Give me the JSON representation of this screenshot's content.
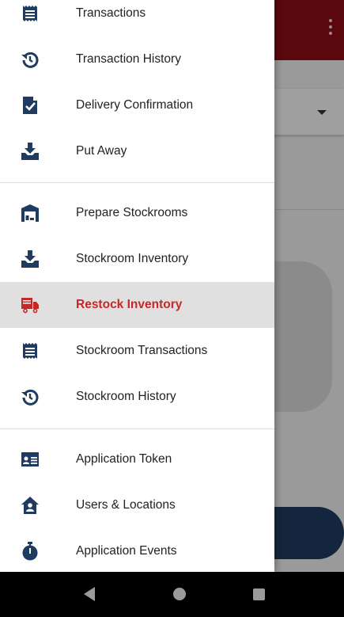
{
  "colors": {
    "icon": "#1f3b5f",
    "accent": "#c62828",
    "appbar": "#8b0d16",
    "selected_bg": "#e0e0e0"
  },
  "drawer": {
    "items": [
      {
        "label": "Transactions",
        "icon": "receipt-icon"
      },
      {
        "label": "Transaction History",
        "icon": "history-icon"
      },
      {
        "label": "Delivery Confirmation",
        "icon": "document-check-icon"
      },
      {
        "label": "Put Away",
        "icon": "tray-download-icon"
      },
      {
        "label": "Prepare Stockrooms",
        "icon": "warehouse-icon"
      },
      {
        "label": "Stockroom Inventory",
        "icon": "tray-download-icon"
      },
      {
        "label": "Restock Inventory",
        "icon": "truck-icon",
        "selected": true
      },
      {
        "label": "Stockroom Transactions",
        "icon": "receipt-icon"
      },
      {
        "label": "Stockroom History",
        "icon": "history-icon"
      },
      {
        "label": "Application Token",
        "icon": "id-card-icon"
      },
      {
        "label": "Users & Locations",
        "icon": "home-user-icon"
      },
      {
        "label": "Application Events",
        "icon": "stopwatch-icon"
      }
    ]
  },
  "system_nav": {
    "back_icon": "back-triangle-icon",
    "home_icon": "home-circle-icon",
    "recents_icon": "recents-square-icon"
  }
}
